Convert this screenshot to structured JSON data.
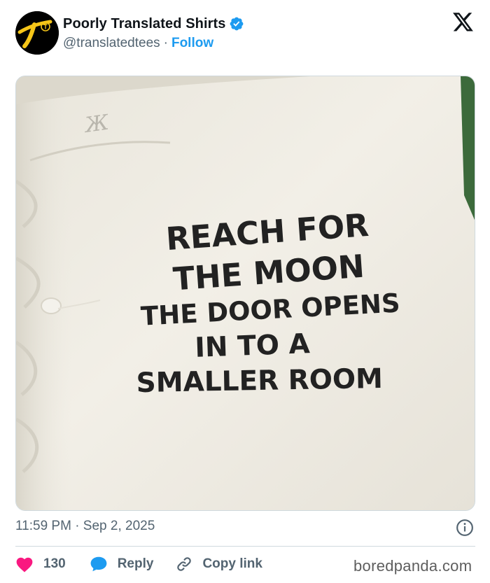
{
  "author": {
    "display_name": "Poorly Translated Shirts",
    "handle": "@translatedtees",
    "separator": "·",
    "follow_label": "Follow",
    "verified": true,
    "avatar_letter": "T"
  },
  "platform_icon": "x-logo-icon",
  "media": {
    "shirt_text_lines": [
      "REACH FOR",
      "THE MOON",
      "THE DOOR OPENS",
      "IN TO A",
      "SMALLER ROOM"
    ]
  },
  "timestamp": "11:59 PM · Sep 2, 2025",
  "actions": {
    "like_count": "130",
    "reply_label": "Reply",
    "copy_link_label": "Copy link"
  },
  "watermark": "boredpanda.com",
  "colors": {
    "accent": "#1d9bf0",
    "like": "#f91880",
    "reply_icon": "#1d9bf0",
    "muted_text": "#536471"
  }
}
